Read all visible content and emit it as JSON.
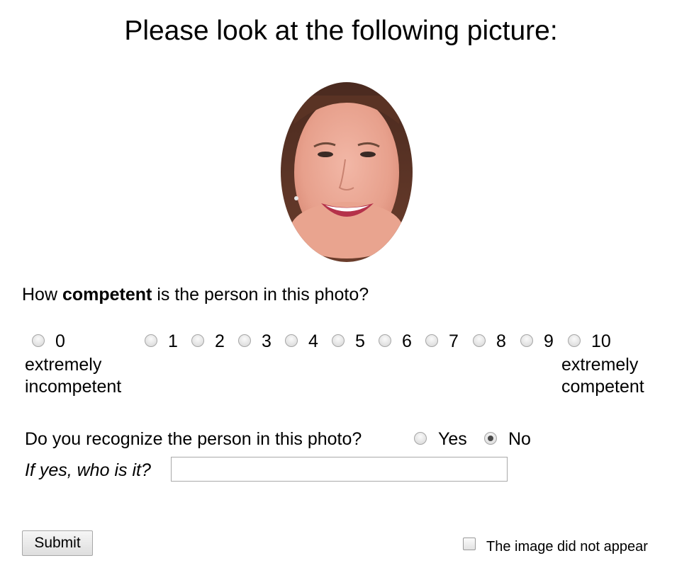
{
  "header": {
    "title": "Please look at the following picture:"
  },
  "photo": {
    "description_icon": "face-photo"
  },
  "question_competence": {
    "prefix": "How ",
    "emphasis": "competent",
    "suffix": " is the person in this photo?",
    "scale": [
      "0",
      "1",
      "2",
      "3",
      "4",
      "5",
      "6",
      "7",
      "8",
      "9",
      "10"
    ],
    "selected": null,
    "low_anchor_line1": "extremely",
    "low_anchor_line2": "incompetent",
    "high_anchor_line1": "extremely",
    "high_anchor_line2": "competent"
  },
  "question_recognize": {
    "label": "Do you recognize the person in this photo?",
    "option_yes": "Yes",
    "option_no": "No",
    "selected": "No"
  },
  "question_who": {
    "label": "If yes, who is it?",
    "value": "",
    "placeholder": ""
  },
  "actions": {
    "submit_label": "Submit",
    "image_missing_label": "The image did not appear",
    "image_missing_checked": false
  },
  "colors": {
    "background": "#ffffff",
    "text": "#000000",
    "radio_dot": "#4a4a4a"
  }
}
